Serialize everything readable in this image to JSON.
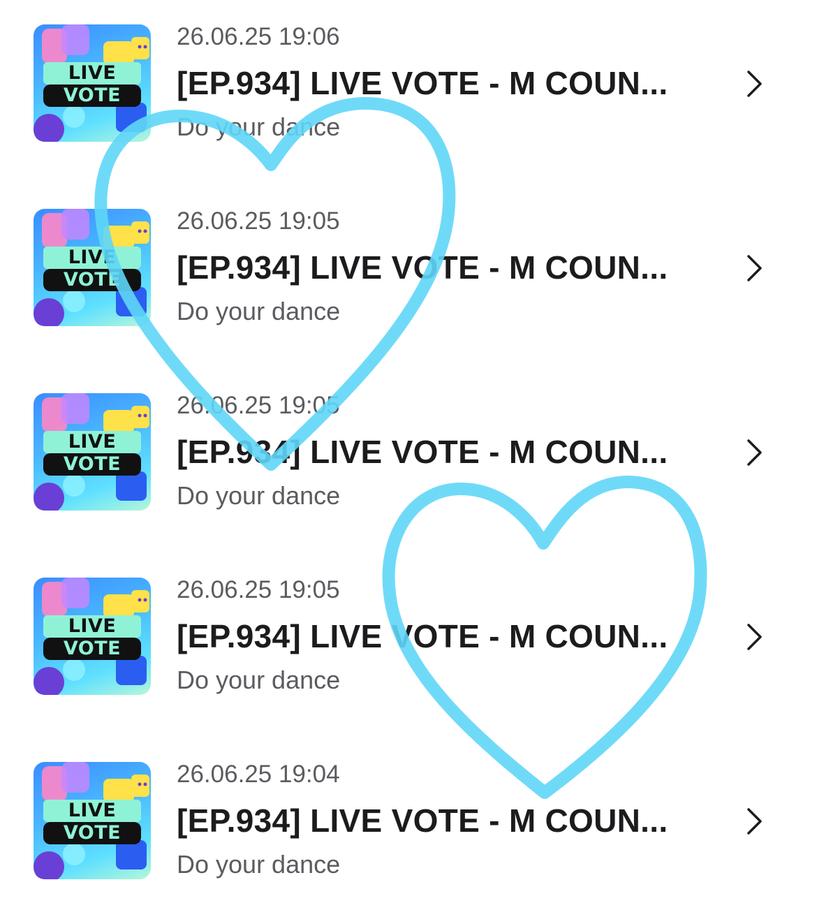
{
  "notifications": [
    {
      "thumbnail": {
        "icon": "live-vote-thumbnail",
        "line1": "LIVE",
        "line2": "VOTE"
      },
      "date": "26.06.25 19:06",
      "title": "[EP.934] LIVE VOTE - M COUN...",
      "subtitle": "Do your dance",
      "chevron_icon": "chevron-right-icon"
    },
    {
      "thumbnail": {
        "icon": "live-vote-thumbnail",
        "line1": "LIVE",
        "line2": "VOTE"
      },
      "date": "26.06.25 19:05",
      "title": "[EP.934] LIVE VOTE - M COUN...",
      "subtitle": "Do your dance",
      "chevron_icon": "chevron-right-icon"
    },
    {
      "thumbnail": {
        "icon": "live-vote-thumbnail",
        "line1": "LIVE",
        "line2": "VOTE"
      },
      "date": "26.06.25 19:05",
      "title": "[EP.934] LIVE VOTE - M COUN...",
      "subtitle": "Do your dance",
      "chevron_icon": "chevron-right-icon"
    },
    {
      "thumbnail": {
        "icon": "live-vote-thumbnail",
        "line1": "LIVE",
        "line2": "VOTE"
      },
      "date": "26.06.25 19:05",
      "title": "[EP.934] LIVE VOTE - M COUN...",
      "subtitle": "Do your dance",
      "chevron_icon": "chevron-right-icon"
    },
    {
      "thumbnail": {
        "icon": "live-vote-thumbnail",
        "line1": "LIVE",
        "line2": "VOTE"
      },
      "date": "26.06.25 19:04",
      "title": "[EP.934] LIVE VOTE - M COUN...",
      "subtitle": "Do your dance",
      "chevron_icon": "chevron-right-icon"
    }
  ],
  "overlay": {
    "icon": "heart-outline-icon",
    "count": 2,
    "color": "#5fd6f7"
  },
  "colors": {
    "background": "#ffffff",
    "title_text": "#1c1c1e",
    "secondary_text": "#5b5b60"
  }
}
